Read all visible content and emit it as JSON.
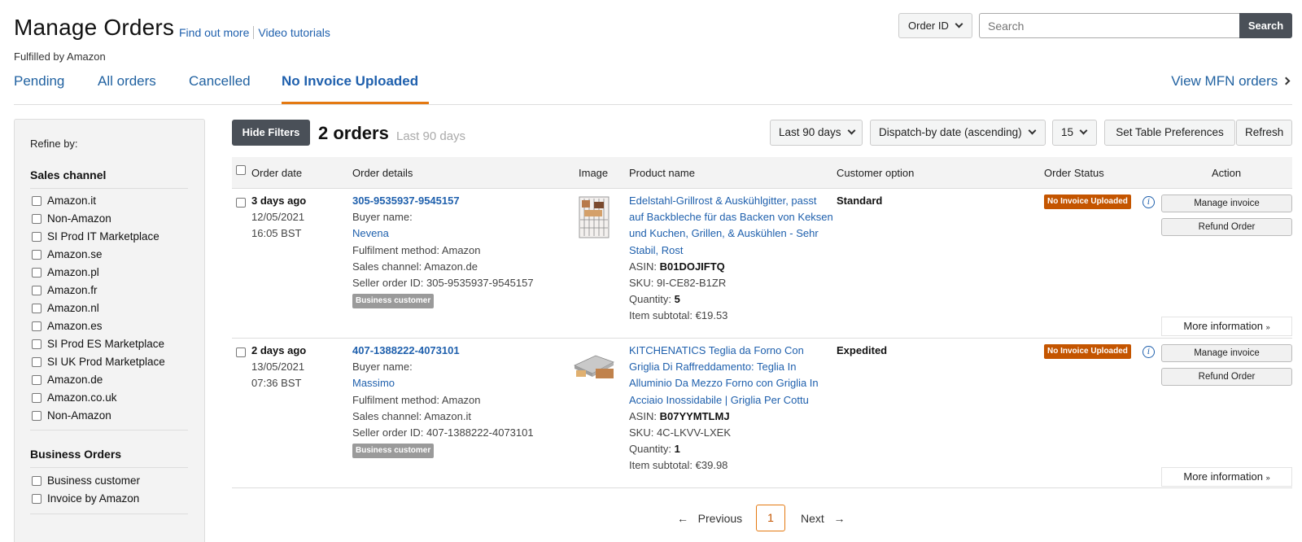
{
  "header": {
    "title": "Manage Orders",
    "find_out_more": "Find out more",
    "video_tutorials": "Video tutorials",
    "subtitle": "Fulfilled by Amazon",
    "search_type": "Order ID",
    "search_placeholder": "Search",
    "search_button": "Search"
  },
  "tabs": [
    "Pending",
    "All orders",
    "Cancelled",
    "No Invoice Uploaded"
  ],
  "active_tab": "No Invoice Uploaded",
  "view_mfn": "View MFN orders",
  "sidebar": {
    "refine_by": "Refine by:",
    "sales_channel_title": "Sales channel",
    "sales_channels": [
      "Amazon.it",
      "Non-Amazon",
      "SI Prod IT Marketplace",
      "Amazon.se",
      "Amazon.pl",
      "Amazon.fr",
      "Amazon.nl",
      "Amazon.es",
      "SI Prod ES Marketplace",
      "SI UK Prod Marketplace",
      "Amazon.de",
      "Amazon.co.uk",
      "Non-Amazon"
    ],
    "business_orders_title": "Business Orders",
    "business_orders": [
      "Business customer",
      "Invoice by Amazon"
    ]
  },
  "toolbar": {
    "hide_filters": "Hide Filters",
    "orders_count": "2 orders",
    "orders_range": "Last 90 days",
    "date_range": "Last 90 days",
    "sort": "Dispatch-by date (ascending)",
    "page_size": "15",
    "table_prefs": "Set Table Preferences",
    "refresh": "Refresh"
  },
  "table": {
    "columns": [
      "Order date",
      "Order details",
      "Image",
      "Product name",
      "Customer option",
      "Order Status",
      "Action"
    ],
    "rows": [
      {
        "relative_date": "3 days ago",
        "date": "12/05/2021",
        "time": "16:05 BST",
        "order_id": "305-9535937-9545157",
        "buyer_label": "Buyer name:",
        "buyer_name": "Nevena",
        "fulfilment": "Fulfilment method: Amazon",
        "sales_channel": "Sales channel: Amazon.de",
        "seller_order_id": "Seller order ID: 305-9535937-9545157",
        "business_badge": "Business customer",
        "product_name": "Edelstahl-Grillrost & Auskühlgitter, passt auf Backbleche für das Backen von Keksen und Kuchen, Grillen, & Auskühlen - Sehr Stabil, Rost",
        "asin_label": "ASIN:",
        "asin": "B01DOJIFTQ",
        "sku": "SKU: 9I-CE82-B1ZR",
        "quantity_label": "Quantity:",
        "quantity": "5",
        "subtotal": "Item subtotal: €19.53",
        "customer_option": "Standard",
        "status": "No Invoice Uploaded",
        "manage_invoice": "Manage invoice",
        "refund_order": "Refund Order",
        "more_info": "More information"
      },
      {
        "relative_date": "2 days ago",
        "date": "13/05/2021",
        "time": "07:36 BST",
        "order_id": "407-1388222-4073101",
        "buyer_label": "Buyer name:",
        "buyer_name": "Massimo",
        "fulfilment": "Fulfilment method: Amazon",
        "sales_channel": "Sales channel: Amazon.it",
        "seller_order_id": "Seller order ID: 407-1388222-4073101",
        "business_badge": "Business customer",
        "product_name": "KITCHENATICS Teglia da Forno Con Griglia Di Raffreddamento: Teglia In Alluminio Da Mezzo Forno con Griglia In Acciaio Inossidabile | Griglia Per Cottu",
        "asin_label": "ASIN:",
        "asin": "B07YYMTLMJ",
        "sku": "SKU: 4C-LKVV-LXEK",
        "quantity_label": "Quantity:",
        "quantity": "1",
        "subtotal": "Item subtotal: €39.98",
        "customer_option": "Expedited",
        "status": "No Invoice Uploaded",
        "manage_invoice": "Manage invoice",
        "refund_order": "Refund Order",
        "more_info": "More information"
      }
    ]
  },
  "pagination": {
    "previous": "Previous",
    "current": "1",
    "next": "Next"
  },
  "colors": {
    "link": "#1f60ad",
    "accent": "#e47911",
    "status": "#c45500",
    "dark_button": "#4a5058"
  },
  "icons": [
    "chevron-down-icon",
    "chevron-right-icon",
    "info-icon",
    "arrow-left-icon",
    "arrow-right-icon",
    "double-chevron-down-icon"
  ]
}
